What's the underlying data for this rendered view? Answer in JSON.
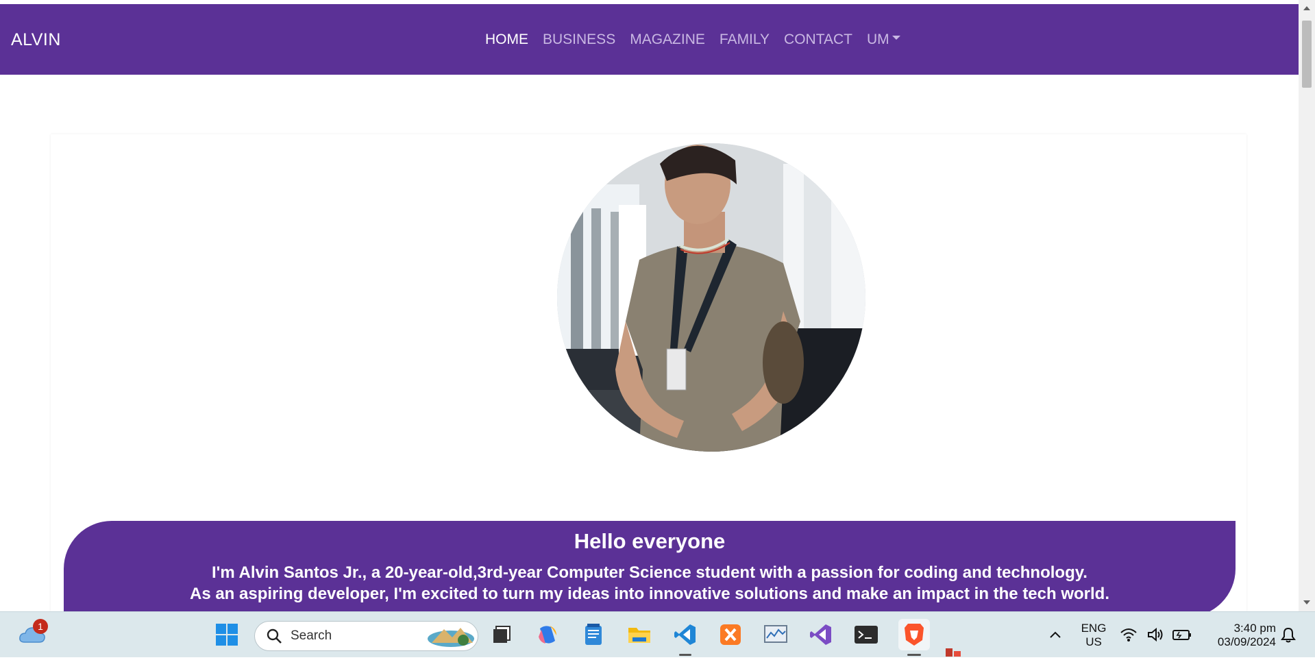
{
  "navbar": {
    "brand": "ALVIN",
    "links": [
      {
        "label": "HOME",
        "active": true
      },
      {
        "label": "BUSINESS",
        "active": false
      },
      {
        "label": "MAGAZINE",
        "active": false
      },
      {
        "label": "FAMILY",
        "active": false
      },
      {
        "label": "CONTACT",
        "active": false
      },
      {
        "label": "UM",
        "active": false,
        "dropdown": true
      }
    ]
  },
  "hero": {
    "photo": "profile-photo"
  },
  "intro": {
    "title": "Hello everyone",
    "line1": "I'm Alvin Santos Jr., a 20-year-old,3rd-year Computer Science student with a passion for coding and technology.",
    "line2": "As an aspiring developer, I'm excited to turn my ideas into innovative solutions and make an impact in the tech world."
  },
  "taskbar": {
    "weather_badge": "1",
    "search_placeholder": "Search",
    "language": {
      "line1": "ENG",
      "line2": "US"
    },
    "time": "3:40 pm",
    "date": "03/09/2024"
  },
  "colors": {
    "brand_purple": "#5b3196",
    "nav_inactive": "#c9b8e3",
    "taskbar_bg": "#dce8ec"
  }
}
